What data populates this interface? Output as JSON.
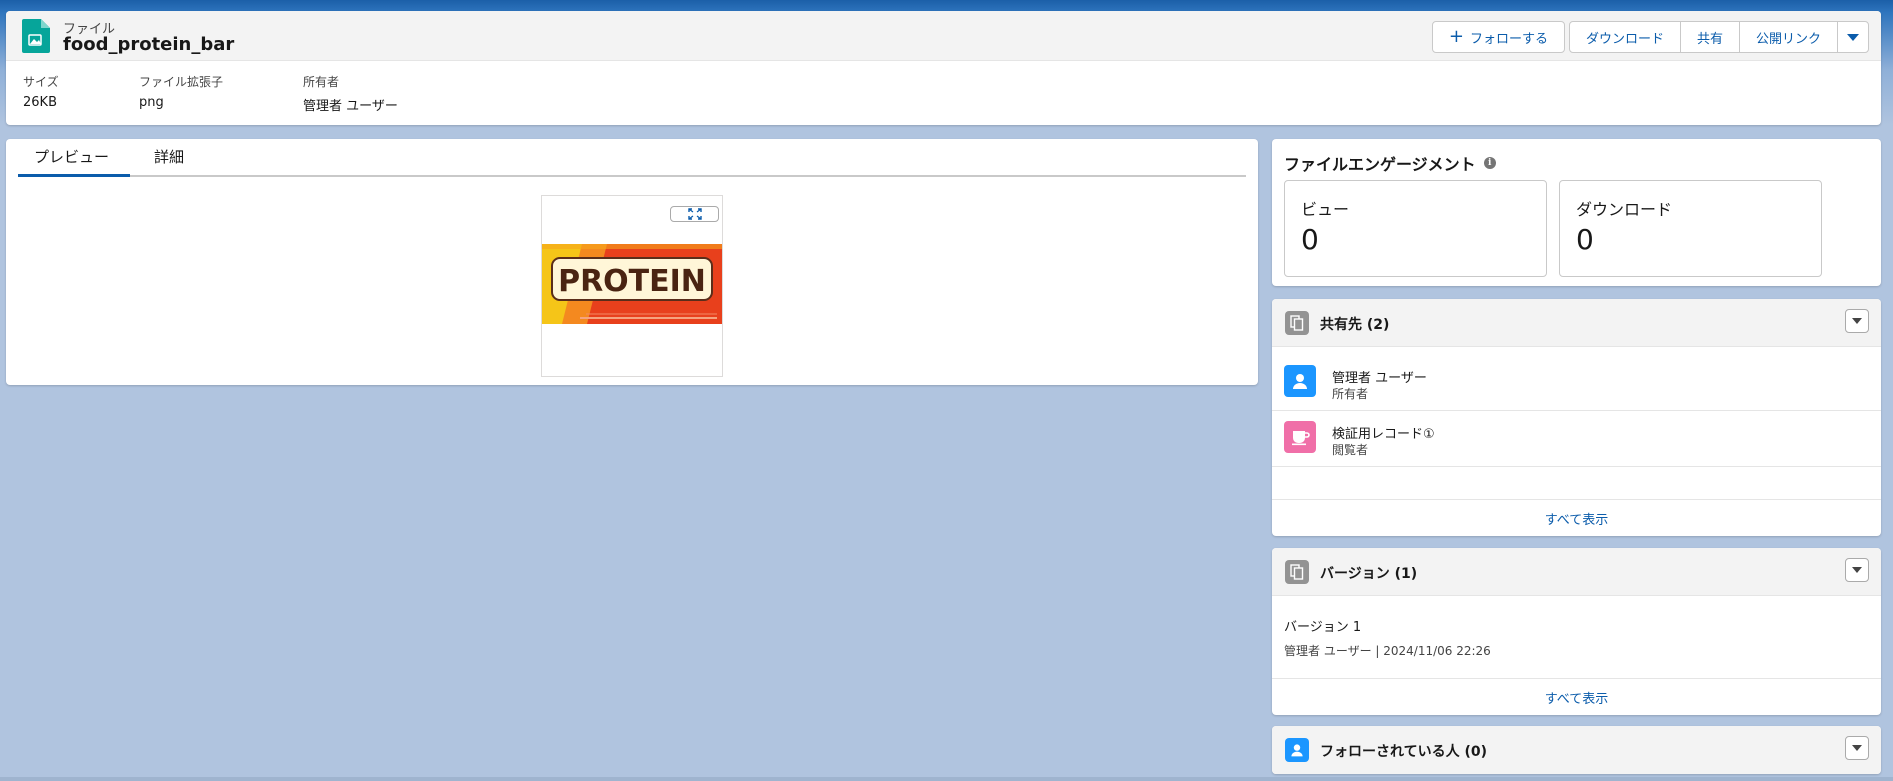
{
  "header": {
    "object_type": "ファイル",
    "title": "food_protein_bar",
    "follow_label": "フォローする",
    "actions": [
      "ダウンロード",
      "共有",
      "公開リンク"
    ],
    "fields": [
      {
        "label": "サイズ",
        "value": "26KB"
      },
      {
        "label": "ファイル拡張子",
        "value": "png"
      },
      {
        "label": "所有者",
        "value": "管理者 ユーザー"
      }
    ]
  },
  "tabs": [
    "プレビュー",
    "詳細"
  ],
  "preview": {
    "image_text": "PROTEIN"
  },
  "engagement": {
    "title": "ファイルエンゲージメント",
    "views_label": "ビュー",
    "views_value": "0",
    "downloads_label": "ダウンロード",
    "downloads_value": "0"
  },
  "shared_with": {
    "title": "共有先 (2)",
    "items": [
      {
        "name": "管理者 ユーザー",
        "role": "所有者"
      },
      {
        "name": "検証用レコード①",
        "role": "閲覧者"
      }
    ],
    "view_all": "すべて表示"
  },
  "versions": {
    "title": "バージョン (1)",
    "items": [
      {
        "name": "バージョン 1",
        "meta": "管理者 ユーザー | 2024/11/06 22:26"
      }
    ],
    "view_all": "すべて表示"
  },
  "followers": {
    "title": "フォローされている人 (0)"
  },
  "colors": {
    "brand_blue": "#0b5cab",
    "file_icon_green": "#06a59a",
    "user_icon_blue": "#1b96ff",
    "record_icon_pink": "#f06fa8"
  }
}
